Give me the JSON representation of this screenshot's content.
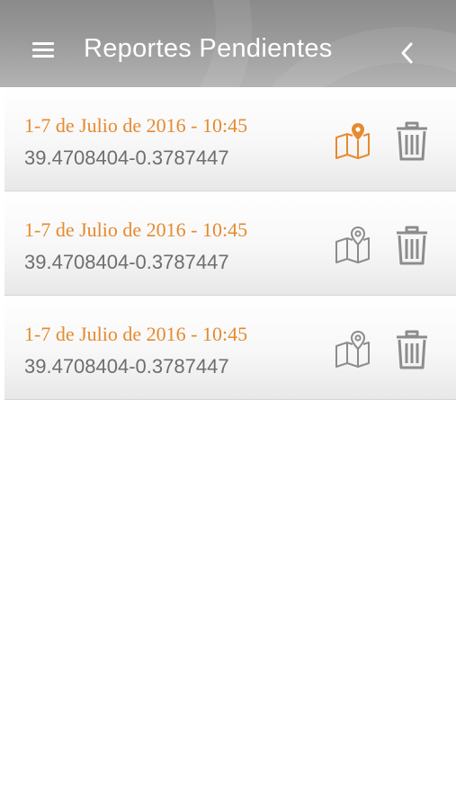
{
  "header": {
    "title": "Reportes Pendientes",
    "menu_icon": "hamburger-menu-icon",
    "back_icon": "chevron-left-icon"
  },
  "colors": {
    "accent": "#e68a2e",
    "icon_gray": "#8c8c8c",
    "text_gray": "#6e6e6e"
  },
  "reports": [
    {
      "date": "1-7 de Julio de 2016 - 10:45",
      "coords": "39.4708404-0.3787447",
      "map_active": true
    },
    {
      "date": "1-7 de Julio de 2016 - 10:45",
      "coords": "39.4708404-0.3787447",
      "map_active": false
    },
    {
      "date": "1-7 de Julio de 2016 - 10:45",
      "coords": "39.4708404-0.3787447",
      "map_active": false
    }
  ]
}
